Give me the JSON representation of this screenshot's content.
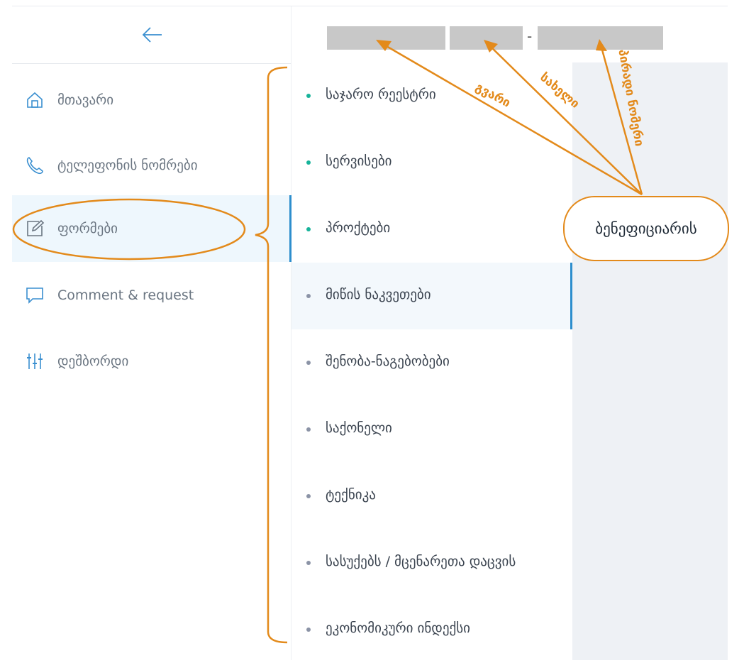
{
  "sidebar": {
    "items": [
      {
        "label": "მთავარი",
        "icon": "home-icon"
      },
      {
        "label": "ტელეფონის ნომრები",
        "icon": "phone-icon"
      },
      {
        "label": "ფორმები",
        "icon": "edit-form-icon",
        "active": true
      },
      {
        "label": "Comment & request",
        "icon": "comment-icon"
      },
      {
        "label": "დეშბორდი",
        "icon": "sliders-icon"
      }
    ]
  },
  "submenu": {
    "items": [
      {
        "label": "საჯარო რეესტრი",
        "dot": "teal"
      },
      {
        "label": "სერვისები",
        "dot": "teal"
      },
      {
        "label": "პროქტები",
        "dot": "teal"
      },
      {
        "label": "მიწის ნაკვეთები",
        "dot": "gray",
        "active": true
      },
      {
        "label": "შენობა-ნაგებობები",
        "dot": "gray"
      },
      {
        "label": "საქონელი",
        "dot": "gray"
      },
      {
        "label": "ტექნიკა",
        "dot": "gray"
      },
      {
        "label": "სასუქებს / მცენარეთა დაცვის",
        "dot": "gray"
      },
      {
        "label": "ეკონომიკური ინდექსი",
        "dot": "gray"
      }
    ]
  },
  "header": {
    "separator": "-"
  },
  "annotations": {
    "callout": "ბენეფიციარის",
    "label_surname": "გვარი",
    "label_name": "სახელი",
    "label_id": "პირადი ნომერი"
  },
  "colors": {
    "accent_orange": "#e38a1b",
    "active_blue": "#2d8ecd",
    "teal_dot": "#17b39a",
    "gray_dot": "#8b93a6",
    "field_gray": "#c8c8c8"
  }
}
